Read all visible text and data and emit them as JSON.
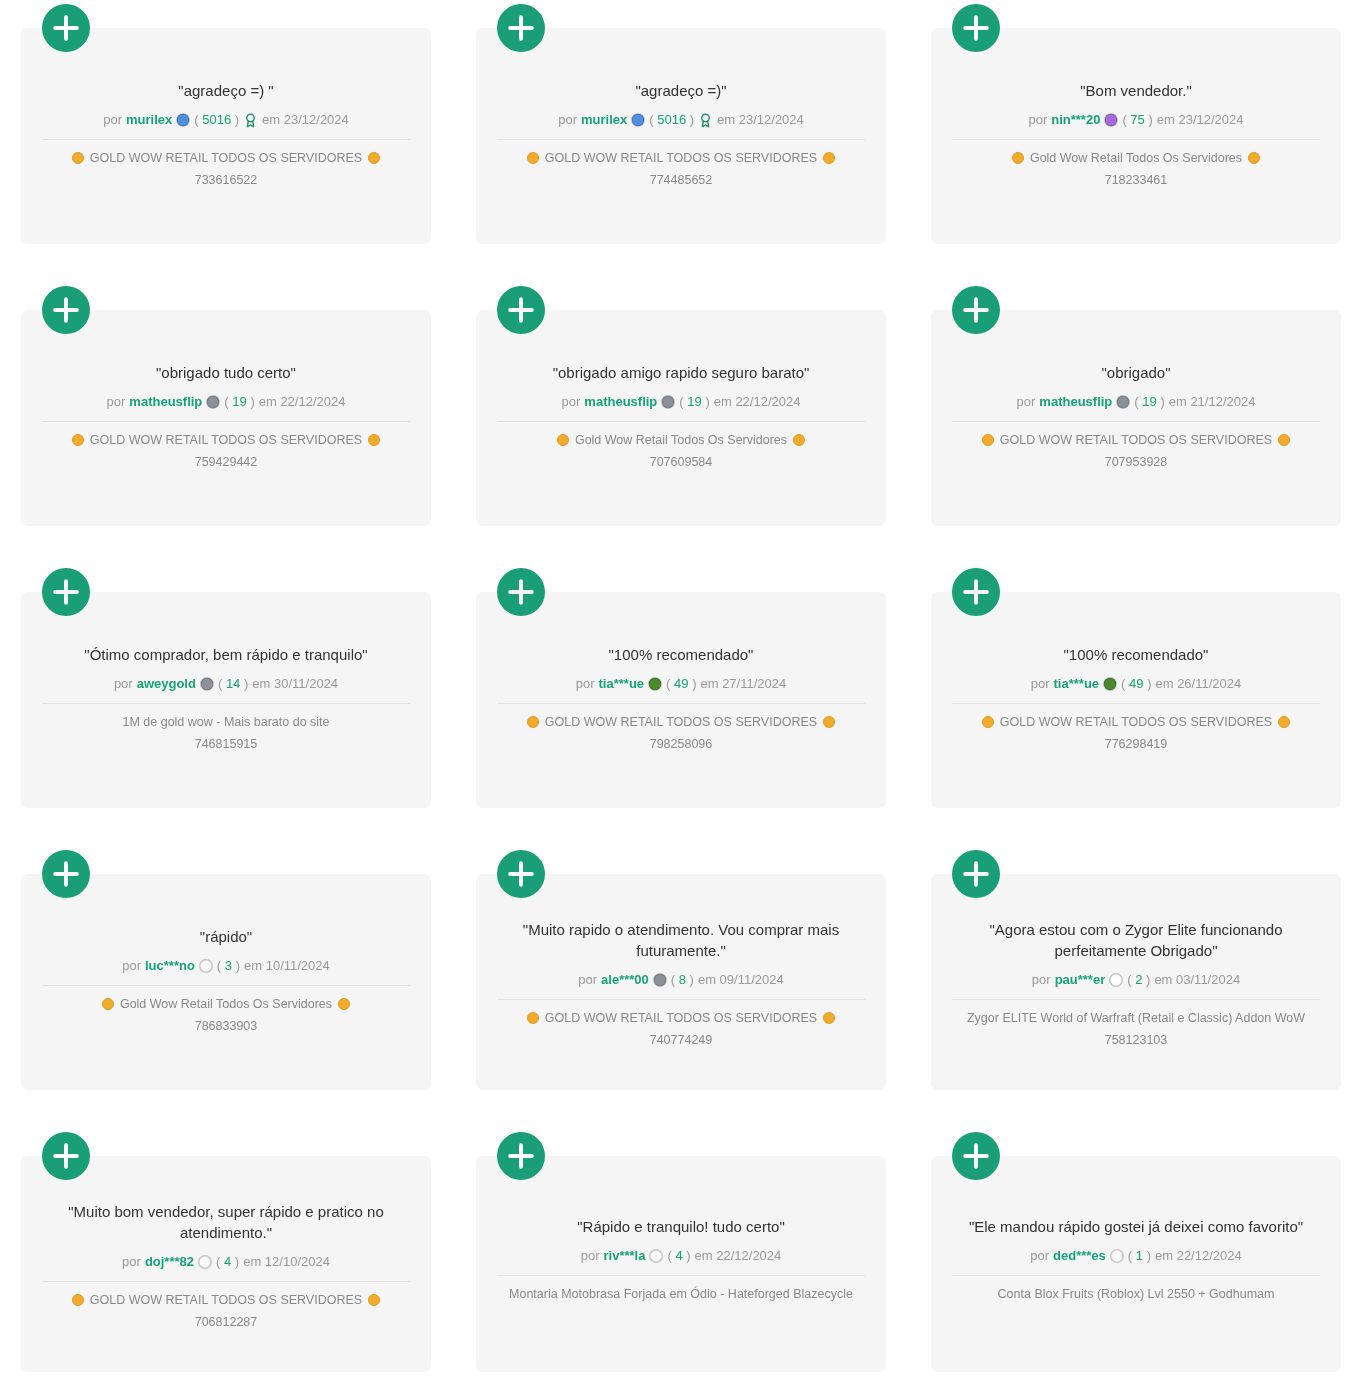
{
  "reviews": [
    {
      "quote": "\"agradeço =) \"",
      "by": "por",
      "user": "murilex",
      "color": "#4f8fe0",
      "score_open": "(",
      "score": "5016",
      "score_close": ")",
      "medal": true,
      "date": "em 23/12/2024",
      "product": "GOLD WOW RETAIL TODOS OS SERVIDORES",
      "coins": true,
      "order_number": "733616522"
    },
    {
      "quote": "\"agradeço =)\"",
      "by": "por",
      "user": "murilex",
      "color": "#4f8fe0",
      "score_open": "(",
      "score": "5016",
      "score_close": ")",
      "medal": true,
      "date": "em 23/12/2024",
      "product": "GOLD WOW RETAIL TODOS OS SERVIDORES",
      "coins": true,
      "order_number": "774485652"
    },
    {
      "quote": "\"Bom vendedor.\"",
      "by": "por",
      "user": "nin***20",
      "color": "#a66bd8",
      "score_open": "(",
      "score": "75",
      "score_close": ")",
      "medal": false,
      "date": "em 23/12/2024",
      "product": "Gold Wow Retail Todos Os Servidores",
      "coins": true,
      "order_number": "718233461"
    },
    {
      "quote": "\"obrigado tudo certo\"",
      "by": "por",
      "user": "matheusflip",
      "color": "#8c9099",
      "score_open": "(",
      "score": "19",
      "score_close": ")",
      "medal": false,
      "date": "em 22/12/2024",
      "product": "GOLD WOW RETAIL TODOS OS SERVIDORES",
      "coins": true,
      "order_number": "759429442"
    },
    {
      "quote": "\"obrigado amigo rapido seguro barato\"",
      "by": "por",
      "user": "matheusflip",
      "color": "#8c9099",
      "score_open": "(",
      "score": "19",
      "score_close": ")",
      "medal": false,
      "date": "em 22/12/2024",
      "product": "Gold Wow Retail Todos Os Servidores",
      "coins": true,
      "order_number": "707609584"
    },
    {
      "quote": "\"obrigado\"",
      "by": "por",
      "user": "matheusflip",
      "color": "#8c9099",
      "score_open": "(",
      "score": "19",
      "score_close": ")",
      "medal": false,
      "date": "em 21/12/2024",
      "product": "GOLD WOW RETAIL TODOS OS SERVIDORES",
      "coins": true,
      "order_number": "707953928"
    },
    {
      "quote": "\"Ótimo comprador, bem rápido e tranquilo\"",
      "by": "por",
      "user": "aweygold",
      "color": "#8c9099",
      "score_open": "(",
      "score": "14",
      "score_close": ")",
      "medal": false,
      "date": "em 30/11/2024",
      "product": "1M de gold wow - Mais barato do site",
      "coins": false,
      "order_number": "746815915"
    },
    {
      "quote": "\"100% recomendado\"",
      "by": "por",
      "user": "tia***ue",
      "color": "#4a8a2c",
      "score_open": "(",
      "score": "49",
      "score_close": ")",
      "medal": false,
      "date": "em 27/11/2024",
      "product": "GOLD WOW RETAIL TODOS OS SERVIDORES",
      "coins": true,
      "order_number": "798258096"
    },
    {
      "quote": "\"100% recomendado\"",
      "by": "por",
      "user": "tia***ue",
      "color": "#4a8a2c",
      "score_open": "(",
      "score": "49",
      "score_close": ")",
      "medal": false,
      "date": "em 26/11/2024",
      "product": "GOLD WOW RETAIL TODOS OS SERVIDORES",
      "coins": true,
      "order_number": "776298419"
    },
    {
      "quote": "\"rápido\"",
      "by": "por",
      "user": "luc***no",
      "color": "#ffffff",
      "score_open": "(",
      "score": "3",
      "score_close": ")",
      "medal": false,
      "date": "em 10/11/2024",
      "product": "Gold Wow Retail Todos Os Servidores",
      "coins": true,
      "order_number": "786833903"
    },
    {
      "quote": "\"Muito rapido o atendimento. Vou comprar mais futuramente.\"",
      "by": "por",
      "user": "ale***00",
      "color": "#8c9099",
      "score_open": "(",
      "score": "8",
      "score_close": ")",
      "medal": false,
      "date": "em 09/11/2024",
      "product": "GOLD WOW RETAIL TODOS OS SERVIDORES",
      "coins": true,
      "order_number": "740774249"
    },
    {
      "quote": "\"Agora estou com o Zygor Elite funcionando perfeitamente Obrigado\"",
      "by": "por",
      "user": "pau***er",
      "color": "#ffffff",
      "score_open": "(",
      "score": "2",
      "score_close": ")",
      "medal": false,
      "date": "em 03/11/2024",
      "product": "Zygor ELITE World of Warfraft (Retail e Classic) Addon WoW",
      "coins": false,
      "order_number": "758123103"
    },
    {
      "quote": "\"Muito bom vendedor, super rápido e pratico no atendimento.\"",
      "by": "por",
      "user": "doj***82",
      "color": "#ffffff",
      "score_open": "(",
      "score": "4",
      "score_close": ")",
      "medal": false,
      "date": "em 12/10/2024",
      "product": "GOLD WOW RETAIL TODOS OS SERVIDORES",
      "coins": true,
      "order_number": "706812287"
    },
    {
      "quote": "\"Rápido e tranquilo! tudo certo\"",
      "by": "por",
      "user": "riv***la",
      "color": "#ffffff",
      "score_open": "(",
      "score": "4",
      "score_close": ")",
      "medal": false,
      "date": "em 22/12/2024",
      "product": "Montaria Motobrasa Forjada em Ódio - Hateforged Blazecycle",
      "coins": false
    },
    {
      "quote": "\"Ele mandou rápido gostei já deixei como favorito\"",
      "by": "por",
      "user": "ded***es",
      "color": "#ffffff",
      "score_open": "(",
      "score": "1",
      "score_close": ")",
      "medal": false,
      "date": "em 22/12/2024",
      "product": "Conta Blox Fruits (Roblox) Lvl 2550 + Godhumam",
      "coins": false
    }
  ]
}
